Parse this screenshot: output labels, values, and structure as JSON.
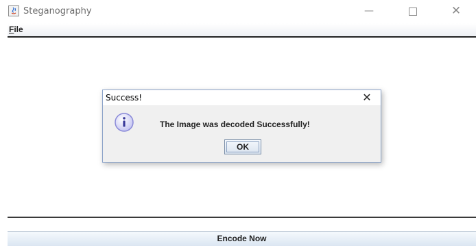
{
  "window": {
    "title": "Steganography",
    "controls": {
      "minimize": "—",
      "close": "✕"
    }
  },
  "menubar": {
    "file_mnemonic": "F",
    "file_rest": "ile"
  },
  "dialog": {
    "title": "Success!",
    "close": "✕",
    "message": "The Image was decoded Successfully!",
    "ok_label": "OK",
    "icon": "info-icon"
  },
  "footer": {
    "encode_label": "Encode Now"
  },
  "colors": {
    "dialog_border": "#8aa2c8",
    "info_icon": "#a5a5ea",
    "button_gradient_top": "#f5f9fd",
    "button_gradient_bottom": "#dbe6f2"
  }
}
